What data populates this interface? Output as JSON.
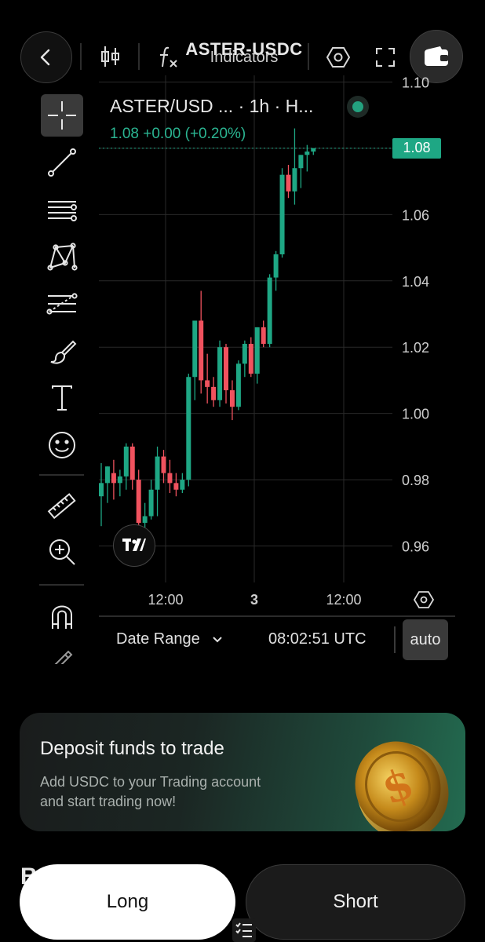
{
  "header": {
    "pair_title": "ASTER-USDC",
    "indicators_label": "Indicators",
    "icons": [
      "back-arrow-icon",
      "candlestick-icon",
      "function-icon",
      "hexagon-settings-icon",
      "fullscreen-icon",
      "wallet-icon"
    ]
  },
  "toolbar": {
    "tools": [
      "crosshair-icon",
      "trend-line-icon",
      "horizontal-lines-icon",
      "pattern-icon",
      "fib-icon",
      "brush-icon",
      "text-icon",
      "emoji-icon",
      "ruler-icon",
      "zoom-in-icon",
      "magnet-icon",
      "pencil-icon"
    ],
    "active_tool": "crosshair-icon"
  },
  "legend": {
    "title": "ASTER/USD ... · 1h · H...",
    "price_line": "1.08  +0.00 (+0.20%)"
  },
  "price_tag": "1.08",
  "chart_data": {
    "type": "candlestick",
    "y_ticks": [
      "1.10",
      "1.08",
      "1.06",
      "1.04",
      "1.02",
      "1.00",
      "0.98",
      "0.96"
    ],
    "ylim": [
      0.949,
      1.102
    ],
    "x_ticks": [
      "12:00",
      "3",
      "12:00"
    ],
    "last_price": 1.08,
    "colors": {
      "up": "#1ea784",
      "down": "#f0525e",
      "grid": "#2a2a2a",
      "axis_text": "#cfcfcf"
    },
    "candles": [
      {
        "o": 0.975,
        "h": 0.985,
        "l": 0.966,
        "c": 0.979
      },
      {
        "o": 0.979,
        "h": 0.984,
        "l": 0.973,
        "c": 0.984
      },
      {
        "o": 0.982,
        "h": 0.986,
        "l": 0.974,
        "c": 0.979
      },
      {
        "o": 0.979,
        "h": 0.983,
        "l": 0.975,
        "c": 0.981
      },
      {
        "o": 0.981,
        "h": 0.991,
        "l": 0.977,
        "c": 0.99
      },
      {
        "o": 0.99,
        "h": 0.991,
        "l": 0.977,
        "c": 0.98
      },
      {
        "o": 0.98,
        "h": 0.983,
        "l": 0.965,
        "c": 0.967
      },
      {
        "o": 0.967,
        "h": 0.973,
        "l": 0.964,
        "c": 0.969
      },
      {
        "o": 0.969,
        "h": 0.98,
        "l": 0.968,
        "c": 0.977
      },
      {
        "o": 0.977,
        "h": 0.99,
        "l": 0.969,
        "c": 0.987
      },
      {
        "o": 0.987,
        "h": 0.989,
        "l": 0.979,
        "c": 0.982
      },
      {
        "o": 0.982,
        "h": 0.986,
        "l": 0.976,
        "c": 0.979
      },
      {
        "o": 0.979,
        "h": 0.982,
        "l": 0.975,
        "c": 0.977
      },
      {
        "o": 0.977,
        "h": 0.982,
        "l": 0.976,
        "c": 0.98
      },
      {
        "o": 0.98,
        "h": 1.012,
        "l": 0.978,
        "c": 1.011
      },
      {
        "o": 1.011,
        "h": 1.024,
        "l": 1.004,
        "c": 1.028
      },
      {
        "o": 1.028,
        "h": 1.037,
        "l": 1.006,
        "c": 1.01
      },
      {
        "o": 1.01,
        "h": 1.018,
        "l": 1.003,
        "c": 1.008
      },
      {
        "o": 1.008,
        "h": 1.011,
        "l": 1.002,
        "c": 1.004
      },
      {
        "o": 1.004,
        "h": 1.022,
        "l": 1.002,
        "c": 1.02
      },
      {
        "o": 1.02,
        "h": 1.021,
        "l": 1.003,
        "c": 1.007
      },
      {
        "o": 1.007,
        "h": 1.01,
        "l": 0.998,
        "c": 1.002
      },
      {
        "o": 1.002,
        "h": 1.016,
        "l": 1.001,
        "c": 1.015
      },
      {
        "o": 1.015,
        "h": 1.022,
        "l": 1.011,
        "c": 1.021
      },
      {
        "o": 1.021,
        "h": 1.023,
        "l": 1.011,
        "c": 1.012
      },
      {
        "o": 1.012,
        "h": 1.026,
        "l": 1.009,
        "c": 1.026
      },
      {
        "o": 1.026,
        "h": 1.028,
        "l": 1.02,
        "c": 1.021
      },
      {
        "o": 1.021,
        "h": 1.042,
        "l": 1.02,
        "c": 1.041
      },
      {
        "o": 1.041,
        "h": 1.049,
        "l": 1.037,
        "c": 1.048
      },
      {
        "o": 1.048,
        "h": 1.074,
        "l": 1.047,
        "c": 1.072
      },
      {
        "o": 1.072,
        "h": 1.075,
        "l": 1.065,
        "c": 1.067
      },
      {
        "o": 1.067,
        "h": 1.086,
        "l": 1.063,
        "c": 1.074
      },
      {
        "o": 1.074,
        "h": 1.078,
        "l": 1.068,
        "c": 1.078
      },
      {
        "o": 1.078,
        "h": 1.081,
        "l": 1.073,
        "c": 1.079
      },
      {
        "o": 1.079,
        "h": 1.08,
        "l": 1.078,
        "c": 1.08
      }
    ]
  },
  "chart_footer": {
    "date_range_label": "Date Range",
    "time": "08:02:51 UTC",
    "scale_mode": "auto"
  },
  "deposit_card": {
    "title": "Deposit funds to trade",
    "description": "Add USDC to your Trading account and start trading now!"
  },
  "actions": {
    "long_label": "Long",
    "short_label": "Short",
    "clipped_heading": "B"
  }
}
